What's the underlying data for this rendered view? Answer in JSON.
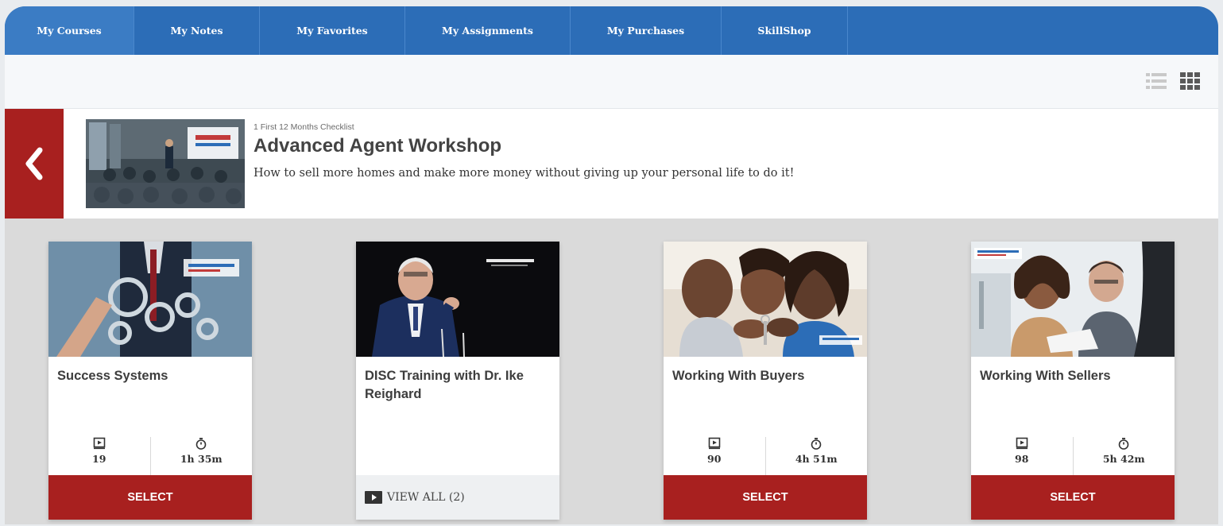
{
  "nav": {
    "tabs": [
      {
        "label": "My Courses",
        "active": true
      },
      {
        "label": "My Notes"
      },
      {
        "label": "My Favorites"
      },
      {
        "label": "My Assignments"
      },
      {
        "label": "My Purchases"
      },
      {
        "label": "SkillShop"
      }
    ]
  },
  "toolbar": {
    "list_view_icon": "list-view-icon",
    "grid_view_icon": "grid-view-icon"
  },
  "header": {
    "back_icon": "chevron-left-icon",
    "kicker": "1 First 12 Months Checklist",
    "title": "Advanced Agent Workshop",
    "description": "How to sell more homes and make more money without giving up your personal life to do it!"
  },
  "cards": [
    {
      "title": "Success Systems",
      "lessons": "19",
      "duration": "1h 35m",
      "action": "SELECT"
    },
    {
      "title": "DISC Training with Dr. Ike Reighard",
      "action": "VIEW ALL (2)"
    },
    {
      "title": "Working With Buyers",
      "lessons": "90",
      "duration": "4h 51m",
      "action": "SELECT"
    },
    {
      "title": "Working With Sellers",
      "lessons": "98",
      "duration": "5h 42m",
      "action": "SELECT"
    }
  ],
  "colors": {
    "nav_blue": "#2c6db7",
    "accent_red": "#a8201f",
    "background": "#dadada"
  }
}
